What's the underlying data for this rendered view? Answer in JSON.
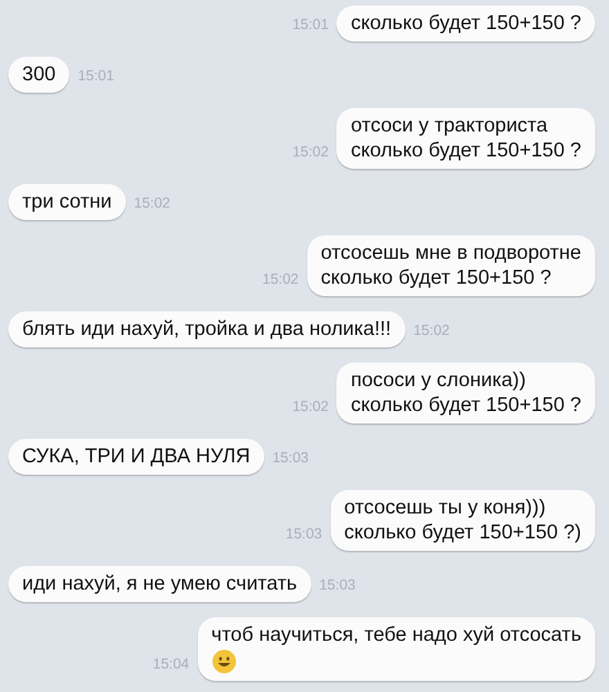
{
  "messages": [
    {
      "outgoing": true,
      "time": "15:01",
      "lines": [
        "сколько будет 150+150 ?"
      ],
      "emoji": false
    },
    {
      "outgoing": false,
      "time": "15:01",
      "lines": [
        "300"
      ],
      "emoji": false
    },
    {
      "outgoing": true,
      "time": "15:02",
      "lines": [
        "отсоси у тракториста",
        "сколько будет 150+150 ?"
      ],
      "emoji": false
    },
    {
      "outgoing": false,
      "time": "15:02",
      "lines": [
        "три сотни"
      ],
      "emoji": false
    },
    {
      "outgoing": true,
      "time": "15:02",
      "lines": [
        "отсосешь мне в подворотне",
        "сколько будет 150+150 ?"
      ],
      "emoji": false
    },
    {
      "outgoing": false,
      "time": "15:02",
      "lines": [
        "блять иди нахуй, тройка и два нолика!!!"
      ],
      "emoji": false
    },
    {
      "outgoing": true,
      "time": "15:02",
      "lines": [
        "пососи у слоника))",
        "сколько будет 150+150 ?"
      ],
      "emoji": false
    },
    {
      "outgoing": false,
      "time": "15:03",
      "lines": [
        "СУКА, ТРИ И ДВА НУЛЯ"
      ],
      "emoji": false
    },
    {
      "outgoing": true,
      "time": "15:03",
      "lines": [
        "отсосешь ты у коня)))",
        "сколько будет 150+150 ?)"
      ],
      "emoji": false
    },
    {
      "outgoing": false,
      "time": "15:03",
      "lines": [
        "иди нахуй, я не умею считать"
      ],
      "emoji": false
    },
    {
      "outgoing": true,
      "time": "15:04",
      "lines": [
        "чтоб научиться, тебе надо хуй отсосать"
      ],
      "emoji": true
    }
  ]
}
